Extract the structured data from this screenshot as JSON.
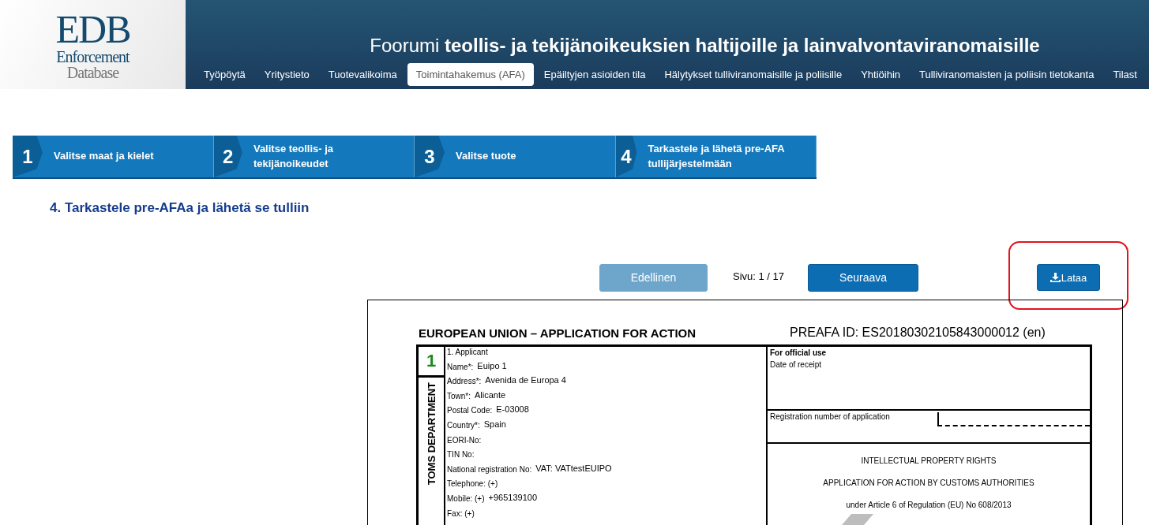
{
  "header": {
    "logo": {
      "title": "EDB",
      "line_1": "Enforcement",
      "line_2": "Database"
    },
    "title_plain": "Foorumi",
    "title_bold": "teollis- ja tekijänoikeuksien haltijoille ja lainvalvontaviranomaisille"
  },
  "nav": [
    {
      "label": "Työpöytä",
      "selected": false
    },
    {
      "label": "Yritystieto",
      "selected": false
    },
    {
      "label": "Tuotevalikoima",
      "selected": false
    },
    {
      "label": "Toimintahakemus (AFA)",
      "selected": true
    },
    {
      "label": "Epäiltyjen asioiden tila",
      "selected": false
    },
    {
      "label": "Hälytykset tulliviranomaisille ja poliisille",
      "selected": false
    },
    {
      "label": "Yhtiöihin",
      "selected": false
    },
    {
      "label": "Tulliviranomaisten ja poliisin tietokanta",
      "selected": false
    },
    {
      "label": "Tilast",
      "selected": false
    }
  ],
  "steps": [
    {
      "number": "1",
      "label": "Valitse maat ja kielet"
    },
    {
      "number": "2",
      "label": "Valitse teollis- ja tekijänoikeudet"
    },
    {
      "number": "3",
      "label": "Valitse tuote"
    },
    {
      "number": "4",
      "label": "Tarkastele ja lähetä pre-AFA tullijärjestelmään"
    }
  ],
  "heading": "4. Tarkastele pre-AFAa ja lähetä se tulliin",
  "pager": {
    "previous": {
      "label": "Edellinen",
      "disabled": true
    },
    "page": "Sivu: 1 / 17",
    "next": {
      "label": "Seuraava",
      "disabled": false
    },
    "download": {
      "label": "Lataa"
    },
    "highlighted": true
  },
  "document": {
    "title": "EUROPEAN UNION – APPLICATION FOR ACTION",
    "preafa_id": "PREAFA ID: ES20180302105843000012 (en)",
    "box_number": "1",
    "side_label": "TOMS DEPARTMENT",
    "section": "1. Applicant",
    "fields": [
      {
        "label": "Name*:",
        "value": "Euipo 1"
      },
      {
        "label": "Address*:",
        "value": "Avenida de Europa 4"
      },
      {
        "label": "Town*:",
        "value": "Alicante"
      },
      {
        "label": "Postal Code:",
        "value": "E-03008"
      },
      {
        "label": "Country*:",
        "value": "Spain"
      },
      {
        "label": "EORI-No:"
      },
      {
        "label": "TIN No:"
      },
      {
        "label": "National registration No:",
        "value": "VAT: VATtestEUIPO"
      },
      {
        "label": "Telephone: (+)"
      },
      {
        "label": "Mobile: (+)",
        "value": "+965139100"
      },
      {
        "label": "Fax: (+)"
      }
    ],
    "official_use": "For official use",
    "date_of_receipt": "Date of receipt",
    "registration_number": "Registration number of application",
    "heading_lines": [
      "INTELLECTUAL PROPERTY RIGHTS",
      "APPLICATION FOR ACTION BY CUSTOMS AUTHORITIES",
      "under Article 6 of Regulation (EU) No 608/2013"
    ]
  }
}
